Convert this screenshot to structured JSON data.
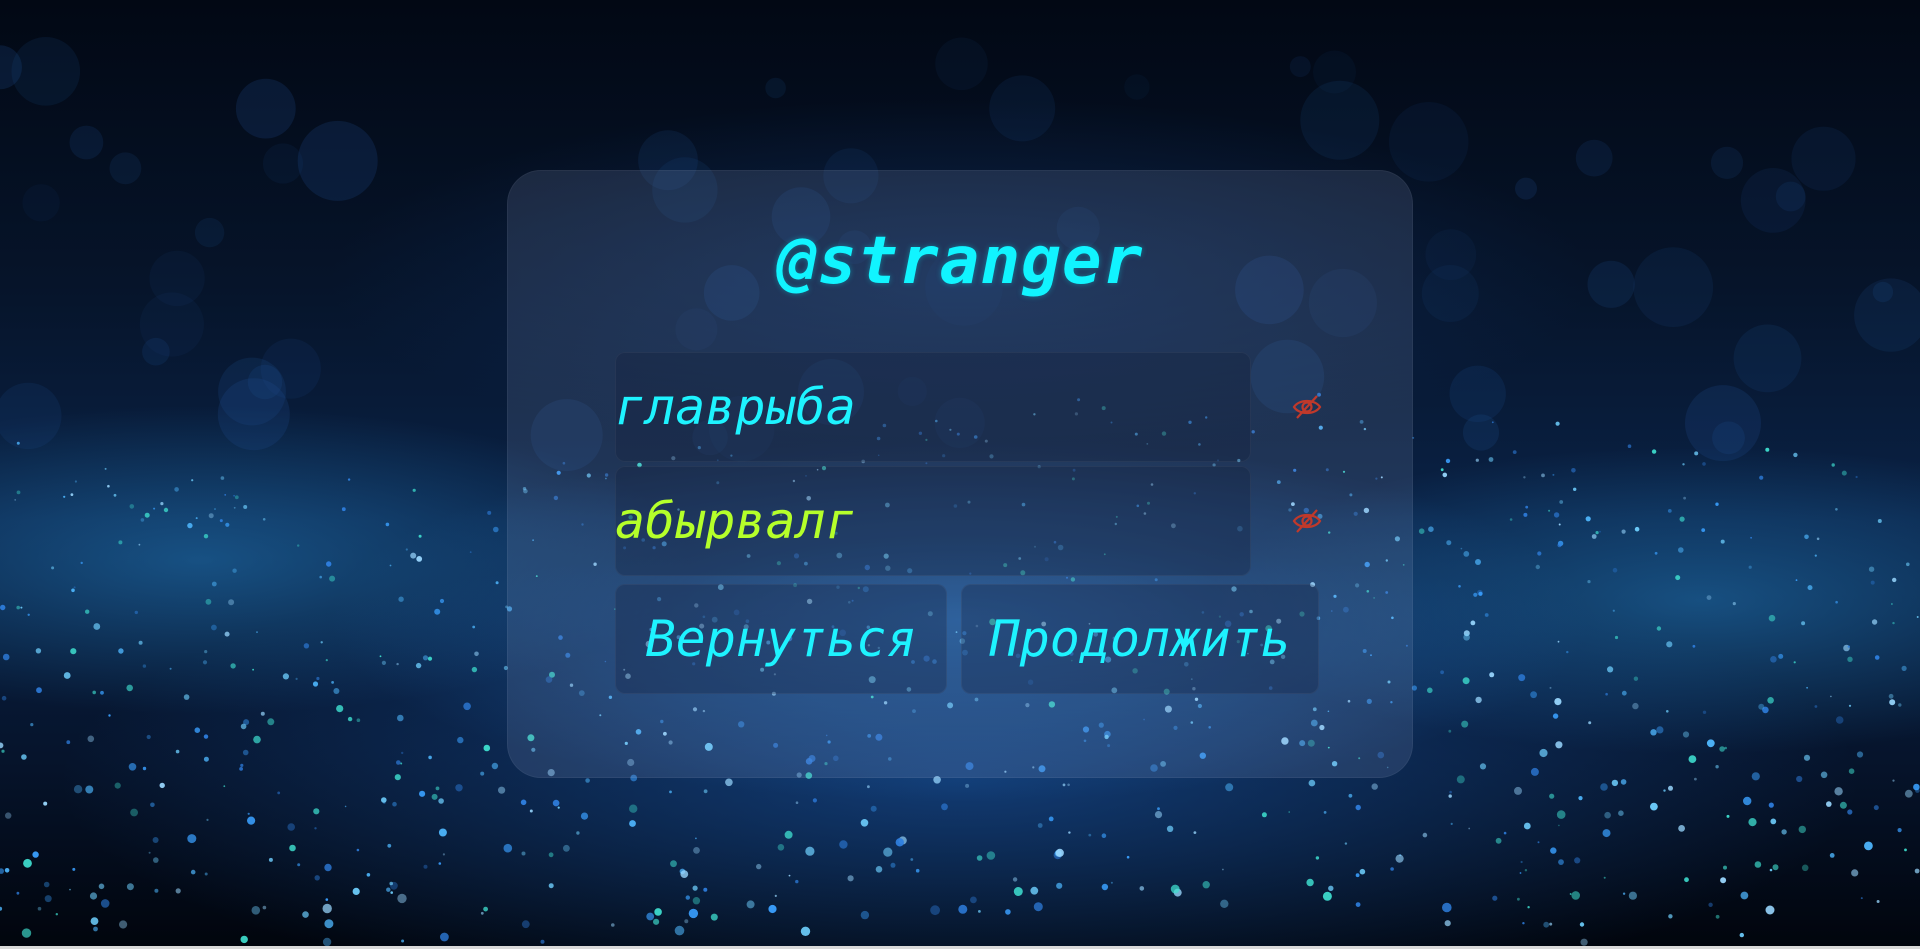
{
  "login_card": {
    "username": "@stranger",
    "login_field": {
      "value": "главрыба"
    },
    "password_field": {
      "value": "абырвалг"
    },
    "buttons": {
      "back_label": "Вернуться",
      "continue_label": "Продолжить"
    },
    "icons": {
      "login_toggle": "eye-slash-icon",
      "password_toggle": "eye-slash-icon"
    }
  },
  "colors": {
    "accent_cyan": "#11f4ff",
    "password_text": "#b5ff2a",
    "icon_red": "#c0392b"
  }
}
